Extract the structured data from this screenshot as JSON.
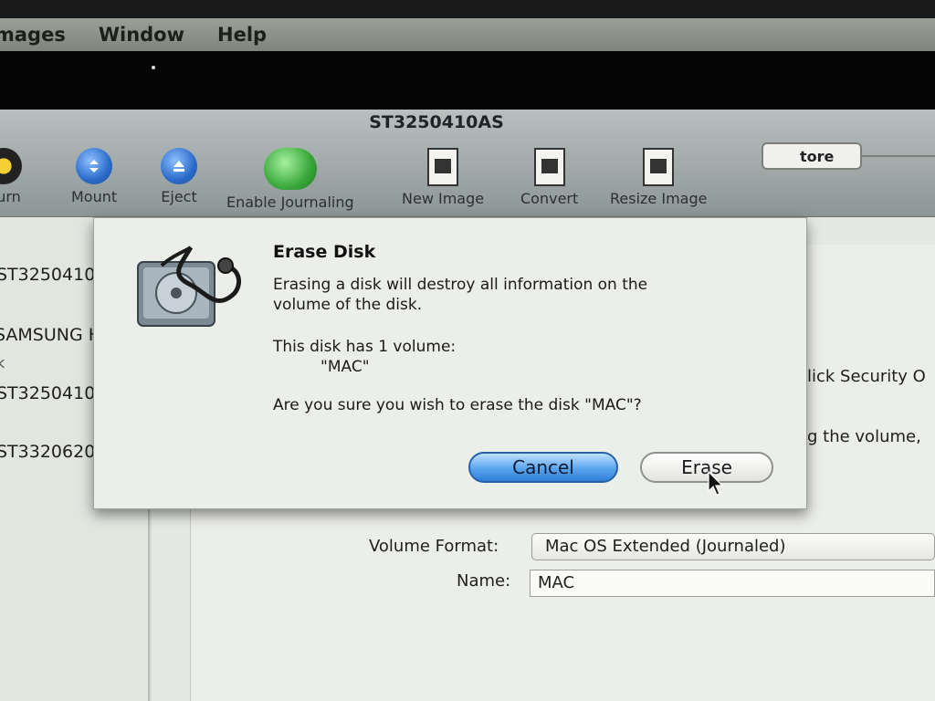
{
  "menubar": {
    "items": [
      "mages",
      "Window",
      "Help"
    ]
  },
  "window": {
    "title": "ST3250410AS",
    "toolbar": [
      {
        "label": "Burn",
        "icon": "burn-icon"
      },
      {
        "label": "Mount",
        "icon": "mount-icon"
      },
      {
        "label": "Eject",
        "icon": "eject-icon"
      },
      {
        "label": "Enable Journaling",
        "icon": "journaling-icon"
      },
      {
        "label": "New Image",
        "icon": "new-image-icon"
      },
      {
        "label": "Convert",
        "icon": "convert-icon"
      },
      {
        "label": "Resize Image",
        "icon": "resize-image-icon"
      }
    ]
  },
  "sidebar": {
    "items": [
      "ST3250410",
      "SAMSUNG H",
      "k",
      "ST3250410",
      "ST3320620"
    ]
  },
  "main": {
    "restore_tab": "tore",
    "security_text": "lick Security O",
    "volume_text": "g the volume,",
    "volume_format_label": "Volume Format:",
    "volume_format_value": "Mac OS Extended (Journaled)",
    "name_label": "Name:",
    "name_value": "MAC"
  },
  "dialog": {
    "title": "Erase Disk",
    "message_line1": "Erasing a disk will destroy all information on the",
    "message_line2": "volume of the disk.",
    "volume_count": "This disk has 1 volume:",
    "volume_name": "\"MAC\"",
    "question": "Are you sure you wish to erase the disk \"MAC\"?",
    "cancel_label": "Cancel",
    "erase_label": "Erase",
    "icon": "disk-utility-icon"
  },
  "colors": {
    "default_button": "#5aa4ee",
    "window_bg": "#d6dad3"
  }
}
